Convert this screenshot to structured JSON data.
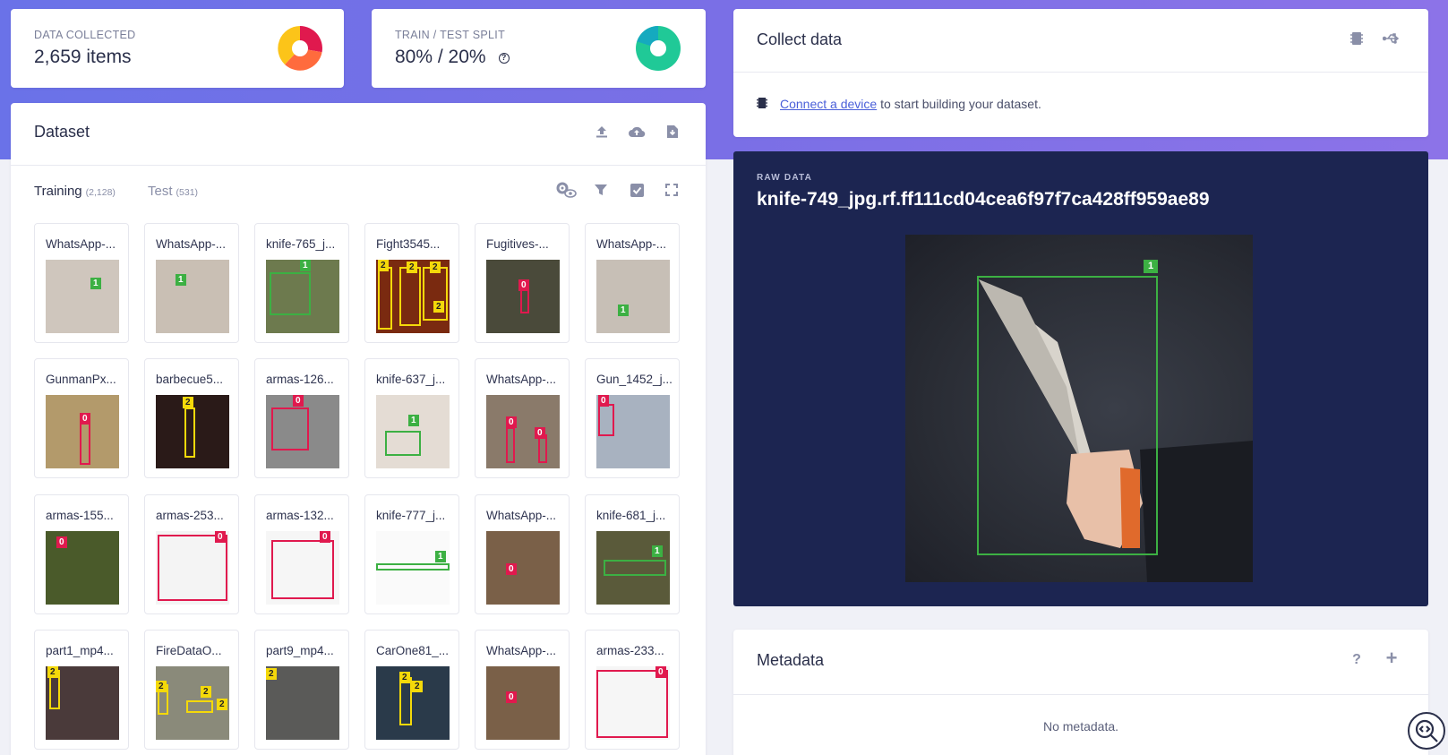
{
  "stats": {
    "collected": {
      "label": "DATA COLLECTED",
      "value": "2,659 items"
    },
    "split": {
      "label": "TRAIN / TEST SPLIT",
      "value": "80% / 20%"
    }
  },
  "dataset": {
    "title": "Dataset",
    "tabs": [
      {
        "label": "Training",
        "count": "(2,128)"
      },
      {
        "label": "Test",
        "count": "(531)"
      }
    ],
    "items": [
      {
        "name": "WhatsApp-...",
        "bg": "#cfc6bd"
      },
      {
        "name": "WhatsApp-...",
        "bg": "#c9bfb4"
      },
      {
        "name": "knife-765_j...",
        "bg": "#6d7a4e"
      },
      {
        "name": "Fight3545...",
        "bg": "#7a2a10"
      },
      {
        "name": "Fugitives-...",
        "bg": "#4a4a3a"
      },
      {
        "name": "WhatsApp-...",
        "bg": "#c7bfb6"
      },
      {
        "name": "GunmanPx...",
        "bg": "#b39a6b"
      },
      {
        "name": "barbecue5...",
        "bg": "#2a1a18"
      },
      {
        "name": "armas-126...",
        "bg": "#8a8a8a"
      },
      {
        "name": "knife-637_j...",
        "bg": "#e4dcd4"
      },
      {
        "name": "WhatsApp-...",
        "bg": "#8a7a6a"
      },
      {
        "name": "Gun_1452_j...",
        "bg": "#a8b2c0"
      },
      {
        "name": "armas-155...",
        "bg": "#4a5a2a"
      },
      {
        "name": "armas-253...",
        "bg": "#f4f4f4"
      },
      {
        "name": "armas-132...",
        "bg": "#f6f6f6"
      },
      {
        "name": "knife-777_j...",
        "bg": "#fafafa"
      },
      {
        "name": "WhatsApp-...",
        "bg": "#7a6048"
      },
      {
        "name": "knife-681_j...",
        "bg": "#5a5a3a"
      },
      {
        "name": "part1_mp4...",
        "bg": "#4a3a3a"
      },
      {
        "name": "FireDataO...",
        "bg": "#8a8a7a"
      },
      {
        "name": "part9_mp4...",
        "bg": "#5a5a58"
      },
      {
        "name": "CarOne81_...",
        "bg": "#2a3a4a"
      },
      {
        "name": "WhatsApp-...",
        "bg": "#7a6048"
      },
      {
        "name": "armas-233...",
        "bg": "#f6f6f6"
      }
    ]
  },
  "collect": {
    "title": "Collect data",
    "link_text": "Connect a device",
    "rest_text": " to start building your dataset."
  },
  "raw": {
    "label": "RAW DATA",
    "filename": "knife-749_jpg.rf.ff111cd04cea6f97f7ca428ff959ae89",
    "box_label": "1"
  },
  "metadata": {
    "title": "Metadata",
    "empty": "No metadata."
  },
  "colors": {
    "label0": "#e0194e",
    "label1": "#3cb043",
    "label2": "#f4d90a"
  }
}
